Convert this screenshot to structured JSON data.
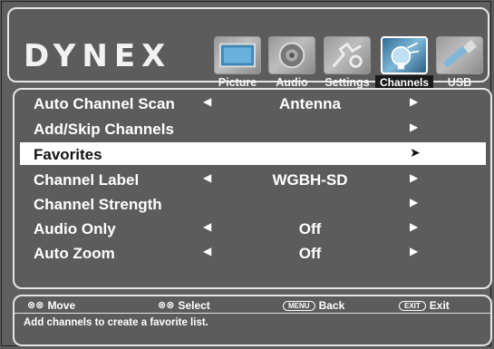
{
  "brand": {
    "logo": "DYNEX"
  },
  "tabs": [
    {
      "label": "Picture",
      "icon": "picture-icon",
      "active": false
    },
    {
      "label": "Audio",
      "icon": "audio-icon",
      "active": false
    },
    {
      "label": "Settings",
      "icon": "settings-icon",
      "active": false
    },
    {
      "label": "Channels",
      "icon": "channels-icon",
      "active": true
    },
    {
      "label": "USB",
      "icon": "usb-icon",
      "active": false
    }
  ],
  "menu": {
    "items": [
      {
        "label": "Auto Channel Scan",
        "left_arrow": "◀",
        "value": "Antenna",
        "right_arrow": "▶",
        "selected": false
      },
      {
        "label": "Add/Skip Channels",
        "left_arrow": "",
        "value": "",
        "right_arrow": "▶",
        "selected": false
      },
      {
        "label": "Favorites",
        "left_arrow": "",
        "value": "",
        "right_arrow": "➤",
        "selected": true
      },
      {
        "label": "Channel Label",
        "left_arrow": "◀",
        "value": "WGBH-SD",
        "right_arrow": "▶",
        "selected": false
      },
      {
        "label": "Channel Strength",
        "left_arrow": "",
        "value": "",
        "right_arrow": "▶",
        "selected": false
      },
      {
        "label": "Audio Only",
        "left_arrow": "◀",
        "value": "Off",
        "right_arrow": "▶",
        "selected": false
      },
      {
        "label": "Auto Zoom",
        "left_arrow": "◀",
        "value": "Off",
        "right_arrow": "▶",
        "selected": false
      }
    ]
  },
  "help": {
    "move": {
      "key": "⊗⊗",
      "label": "Move"
    },
    "select": {
      "key": "⊗⊗",
      "label": "Select"
    },
    "back": {
      "key": "MENU",
      "label": "Back"
    },
    "exit": {
      "key": "EXIT",
      "label": "Exit"
    },
    "hint": "Add channels to create a favorite list."
  },
  "colors": {
    "background": "#5c5c5c",
    "highlight": "#ffffff",
    "panel_border": "#e6e6e6",
    "active_tab": "#2e6f96"
  }
}
